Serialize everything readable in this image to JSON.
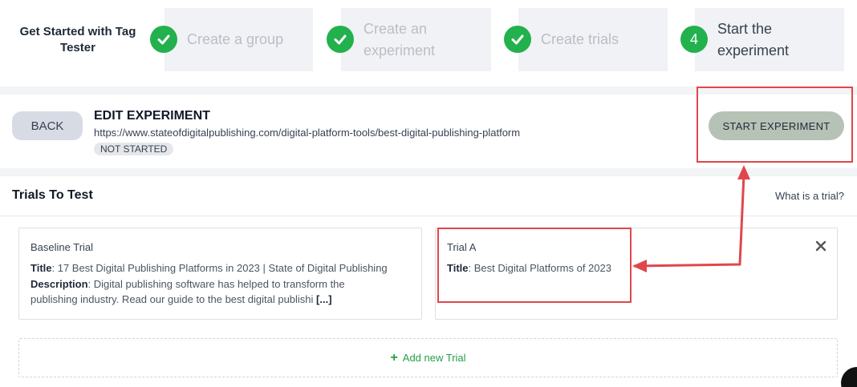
{
  "stepper": {
    "title": "Get Started with Tag Tester",
    "steps": [
      {
        "label": "Create a group",
        "state": "done"
      },
      {
        "label": "Create an experiment",
        "state": "done"
      },
      {
        "label": "Create trials",
        "state": "done"
      },
      {
        "label": "Start the experiment",
        "state": "active",
        "number": "4"
      }
    ]
  },
  "experiment": {
    "back_label": "BACK",
    "title": "EDIT EXPERIMENT",
    "url": "https://www.stateofdigitalpublishing.com/digital-platform-tools/best-digital-publishing-platform",
    "status": "NOT STARTED",
    "start_label": "START EXPERIMENT"
  },
  "trials": {
    "title": "Trials To Test",
    "help_link": "What is a trial?",
    "cards": [
      {
        "name": "Baseline Trial",
        "title_label": "Title",
        "title_value": ": 17 Best Digital Publishing Platforms in 2023 | State of Digital Publishing",
        "description_label": "Description",
        "description_value": ": Digital publishing software has helped to transform the",
        "description_value_2": "publishing industry. Read our guide to the best digital publishi ",
        "more": "[...]"
      },
      {
        "name": "Trial A",
        "title_label": "Title",
        "title_value": ": Best Digital Platforms of 2023"
      }
    ],
    "add_label": "Add new Trial"
  },
  "colors": {
    "accent_green": "#22b14c",
    "annotation_red": "#e0474c"
  }
}
